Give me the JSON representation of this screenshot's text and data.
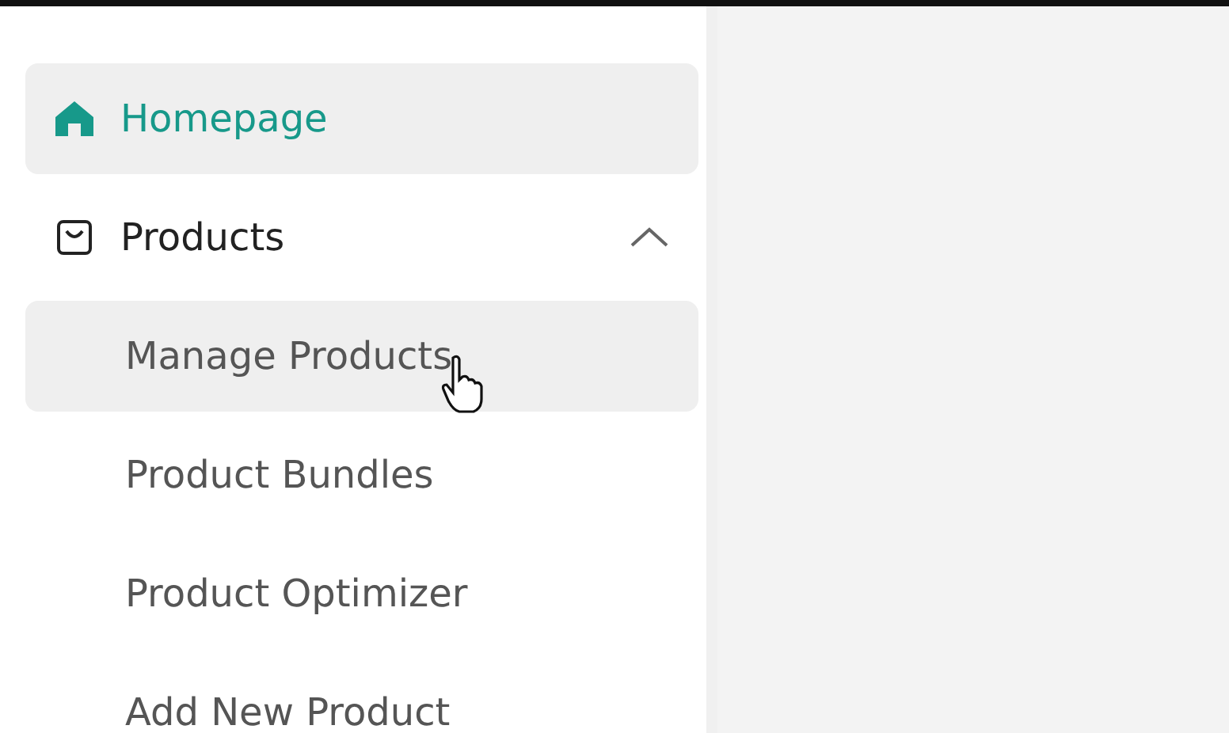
{
  "sidebar": {
    "items": [
      {
        "kind": "link",
        "label": "Homepage",
        "selected": true,
        "highlighted": false
      },
      {
        "kind": "group",
        "label": "Products",
        "selected": false,
        "highlighted": false,
        "expanded": true,
        "children": [
          {
            "label": "Manage Products",
            "selected": false,
            "highlighted": true
          },
          {
            "label": "Product Bundles",
            "selected": false,
            "highlighted": false
          },
          {
            "label": "Product Optimizer",
            "selected": false,
            "highlighted": false
          },
          {
            "label": "Add New Product",
            "selected": false,
            "highlighted": false
          }
        ]
      }
    ]
  }
}
